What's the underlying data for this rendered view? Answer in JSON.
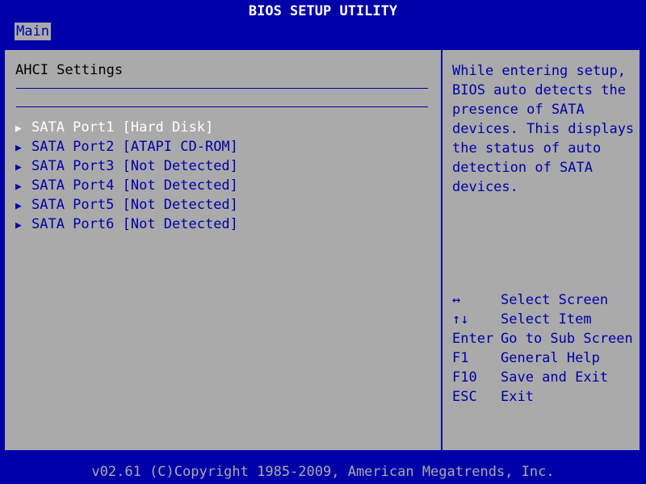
{
  "title": "BIOS SETUP UTILITY",
  "menu": {
    "active_tab": "Main"
  },
  "section_title": "AHCI Settings",
  "items": [
    {
      "arrow": "▶",
      "label": "SATA Port1",
      "value": "[Hard Disk]",
      "selected": true
    },
    {
      "arrow": "▶",
      "label": "SATA Port2",
      "value": "[ATAPI CD-ROM]"
    },
    {
      "arrow": "▶",
      "label": "SATA Port3",
      "value": "[Not Detected]"
    },
    {
      "arrow": "▶",
      "label": "SATA Port4",
      "value": "[Not Detected]"
    },
    {
      "arrow": "▶",
      "label": "SATA Port5",
      "value": "[Not Detected]"
    },
    {
      "arrow": "▶",
      "label": "SATA Port6",
      "value": "[Not Detected]"
    }
  ],
  "help_text": "While entering setup,\nBIOS auto detects the\npresence of SATA\ndevices. This displays\nthe status of auto\ndetection of SATA\ndevices.",
  "keys": [
    {
      "key": "↔",
      "action": "Select Screen"
    },
    {
      "key": "↑↓",
      "action": "Select Item"
    },
    {
      "key": "Enter",
      "action": "Go to Sub Screen"
    },
    {
      "key": "F1",
      "action": "General Help"
    },
    {
      "key": "F10",
      "action": "Save and Exit"
    },
    {
      "key": "ESC",
      "action": "Exit"
    }
  ],
  "footer": "v02.61 (C)Copyright 1985-2009, American Megatrends, Inc.",
  "colors": {
    "background": "#0000a8",
    "panel": "#aaaaaa",
    "highlight_text": "#ffffff",
    "item_text": "#0000a8"
  }
}
